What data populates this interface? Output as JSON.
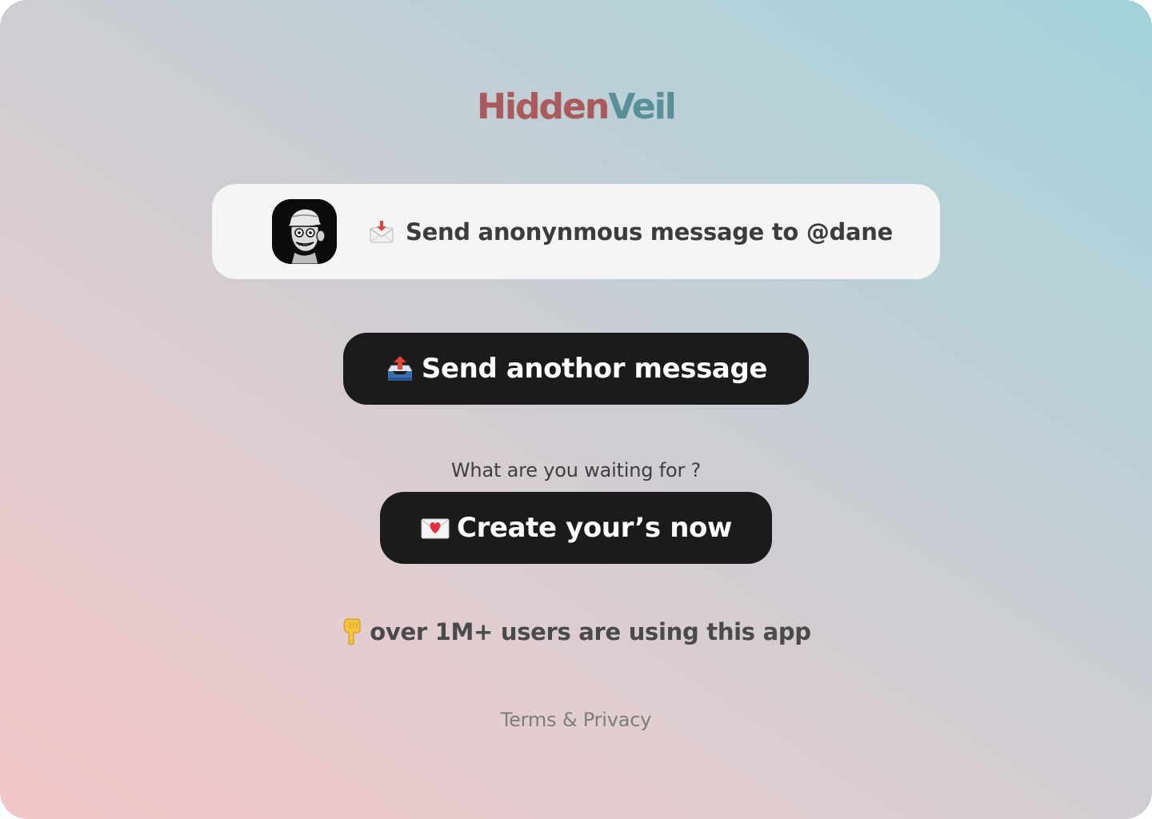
{
  "brand": {
    "name_part1": "Hidden",
    "name_part2": "Veil",
    "color_part1": "#a85a5d",
    "color_part2": "#5a8f98"
  },
  "profile_card": {
    "avatar_icon": "cartoon-skull-avatar",
    "icon": "envelope-with-arrow-icon",
    "message": "Send anonynmous message to @dane"
  },
  "send_another_button": {
    "icon": "outbox-tray-icon",
    "label": "Send anothor message"
  },
  "prompt": {
    "text": "What are you waiting for ?"
  },
  "create_button": {
    "icon": "love-letter-icon",
    "label": "Create your’s now"
  },
  "social_proof": {
    "icon": "pointing-down-hand-icon",
    "text": "over 1M+ users are using this app"
  },
  "footer": {
    "link": "Terms & Privacy"
  },
  "colors": {
    "button_bg": "#1b1b1b",
    "card_bg": "#f5f5f5"
  }
}
